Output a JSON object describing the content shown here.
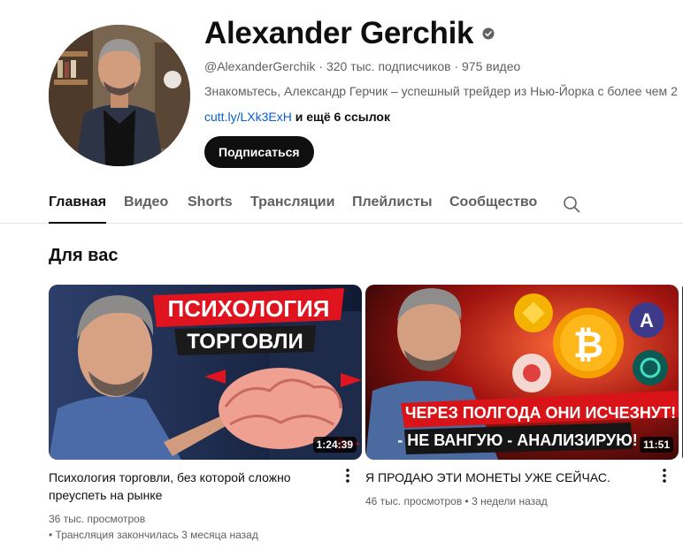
{
  "channel": {
    "name": "Alexander Gerchik",
    "handle": "@AlexanderGerchik",
    "subscribers": "320 тыс. подписчиков",
    "videos": "975 видео",
    "description": "Знакомьтесь, Александр Герчик – успешный трейдер из Нью-Йорка с более чем 2",
    "link": "cutt.ly/LXk3ExH",
    "more_links": "и ещё 6 ссылок",
    "subscribe_label": "Подписаться",
    "verified_icon": "check-circle-icon"
  },
  "tabs": [
    {
      "label": "Главная",
      "active": true
    },
    {
      "label": "Видео",
      "active": false
    },
    {
      "label": "Shorts",
      "active": false
    },
    {
      "label": "Трансляции",
      "active": false
    },
    {
      "label": "Плейлисты",
      "active": false
    },
    {
      "label": "Сообщество",
      "active": false
    }
  ],
  "search_icon": "search-icon",
  "section": {
    "title": "Для вас"
  },
  "videos": [
    {
      "thumbnail_text_1": "ПСИХОЛОГИЯ",
      "thumbnail_text_2": "ТОРГОВЛИ",
      "duration": "1:24:39",
      "title": "Психология торговли, без которой сложно преуспеть на рынке",
      "views": "36 тыс. просмотров",
      "status": "Трансляция закончилась 3 месяца назад"
    },
    {
      "thumbnail_text_1": "ЧЕРЕЗ ПОЛГОДА ОНИ ИСЧЕЗНУТ!",
      "thumbnail_text_2": "- НЕ ВАНГУЮ - АНАЛИЗИРУЮ!",
      "duration": "11:51",
      "title": "Я ПРОДАЮ ЭТИ МОНЕТЫ УЖЕ СЕЙЧАС.",
      "views": "46 тыс. просмотров",
      "age": "3 недели назад"
    }
  ],
  "colors": {
    "accent": "#0f0f0f",
    "link": "#065fd4",
    "secondary_text": "#606060",
    "thumb_red": "#e0141e",
    "coin_gold": "#f5b301"
  }
}
